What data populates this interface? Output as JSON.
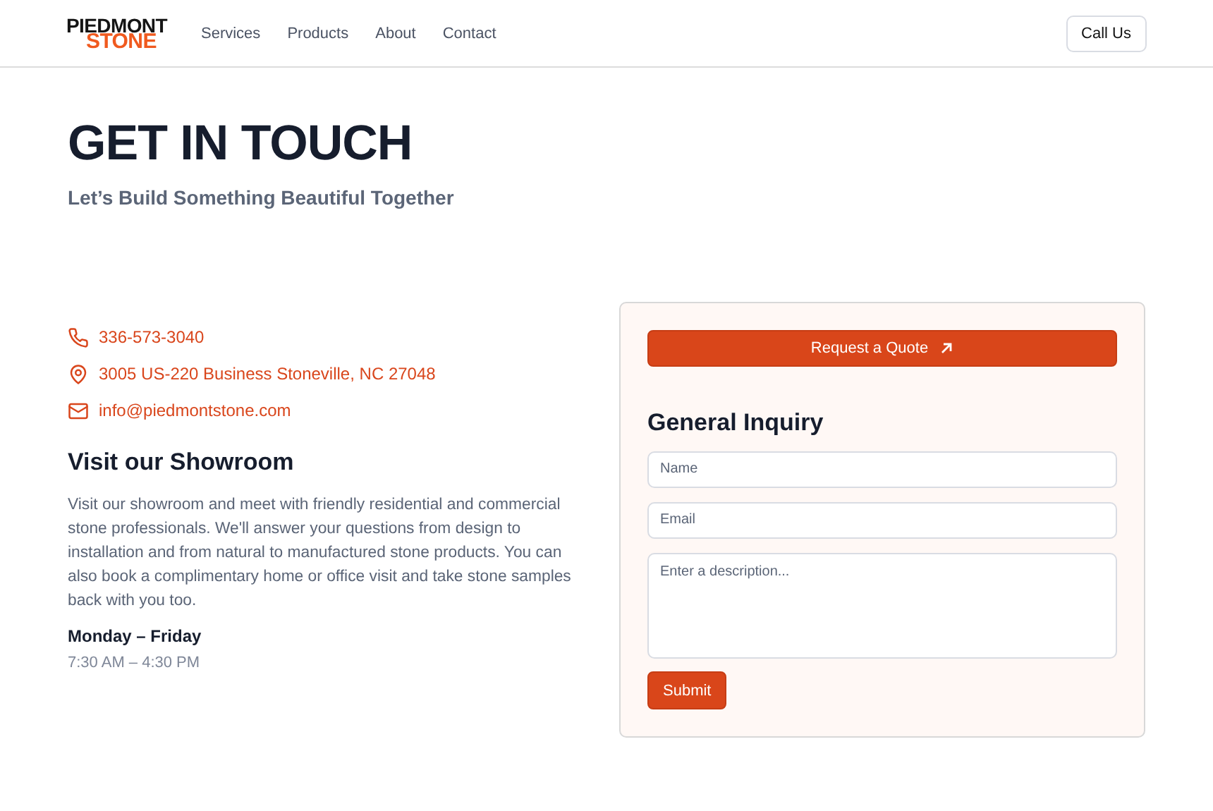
{
  "header": {
    "logo": {
      "line_1": "PIEDMONT",
      "line_2": "STONE"
    },
    "nav": [
      {
        "label": "Services"
      },
      {
        "label": "Products"
      },
      {
        "label": "About"
      },
      {
        "label": "Contact"
      }
    ],
    "call_button": "Call Us"
  },
  "hero": {
    "title": "GET IN TOUCH",
    "subtitle": "Let’s Build Something Beautiful Together"
  },
  "contacts": [
    {
      "kind": "phone",
      "text": "336-573-3040"
    },
    {
      "kind": "location",
      "text": "3005 US-220 Business Stoneville, NC 27048"
    },
    {
      "kind": "email",
      "text": "info@piedmontstone.com"
    }
  ],
  "showroom": {
    "heading": "Visit our Showroom",
    "body": "Visit our showroom and meet with friendly residential and commercial stone professionals. We'll answer your questions from design to installation and from natural to manufactured stone products. You can also book a complimentary home or office visit and take stone samples back with you too.",
    "days": "Monday – Friday",
    "hours": "7:30 AM – 4:30 PM"
  },
  "form": {
    "quote_button": "Request a Quote",
    "heading": "General Inquiry",
    "fields": [
      {
        "kind": "input",
        "placeholder": "Name"
      },
      {
        "kind": "input",
        "placeholder": "Email"
      },
      {
        "kind": "textarea",
        "placeholder": "Enter a description..."
      }
    ],
    "submit": "Submit"
  }
}
